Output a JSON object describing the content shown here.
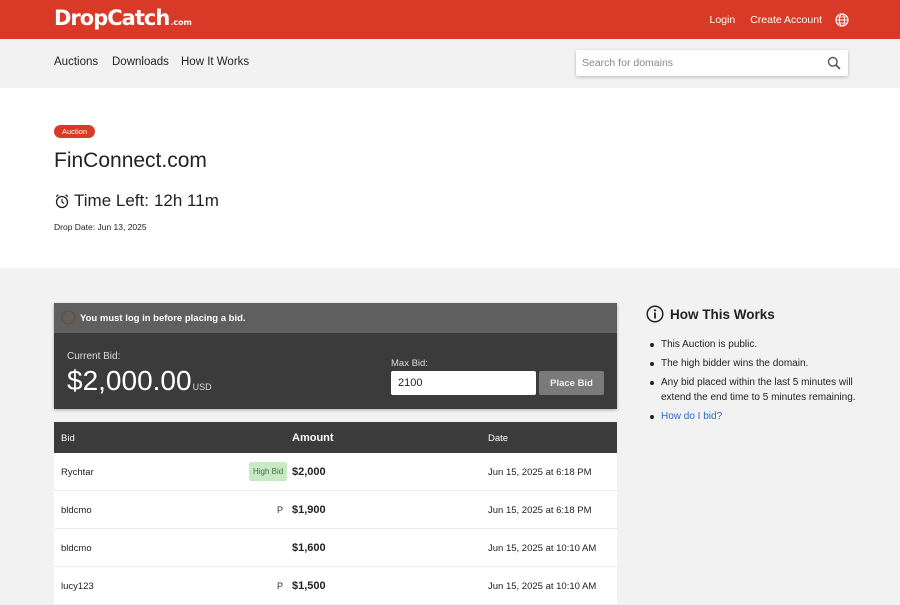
{
  "header": {
    "logo_main": "DropCatch",
    "logo_suffix": ".com",
    "login": "Login",
    "create_account": "Create Account",
    "language_icon": "globe-icon",
    "brand_color": "#d93a28"
  },
  "nav": {
    "items": [
      "Auctions",
      "Downloads",
      "How It Works"
    ],
    "search_placeholder": "Search for domains",
    "search_icon": "search-icon"
  },
  "listing": {
    "badge": "Auction",
    "domain": "FinConnect.com",
    "time_left_label": "Time Left:",
    "time_left_value": "12h 11m",
    "drop_date": "Drop Date: Jun 13, 2025"
  },
  "bid_panel": {
    "login_notice": "You must log in before placing a bid.",
    "current_bid_label": "Current Bid:",
    "current_bid_value": "$2,000.00",
    "current_bid_unit": "USD",
    "max_bid_label": "Max Bid:",
    "max_bid_value": "2100",
    "place_bid": "Place Bid"
  },
  "bids_table": {
    "columns": [
      "Bid",
      "Amount",
      "Date"
    ],
    "rows": [
      {
        "bidder": "Rychtar",
        "tag": "High Bid",
        "amount": "$2,000",
        "date": "Jun 15, 2025 at 6:18 PM"
      },
      {
        "bidder": "bldcmo",
        "tag": "P",
        "amount": "$1,900",
        "date": "Jun 15, 2025 at 6:18 PM"
      },
      {
        "bidder": "bldcmo",
        "tag": "",
        "amount": "$1,600",
        "date": "Jun 15, 2025 at 10:10 AM"
      },
      {
        "bidder": "lucy123",
        "tag": "P",
        "amount": "$1,500",
        "date": "Jun 15, 2025 at 10:10 AM"
      }
    ]
  },
  "how_it_works": {
    "title": "How This Works",
    "items": [
      "This Auction is public.",
      "The high bidder wins the domain.",
      "Any bid placed within the last 5 minutes will extend the end time to 5 minutes remaining."
    ],
    "link": "How do I bid?"
  }
}
